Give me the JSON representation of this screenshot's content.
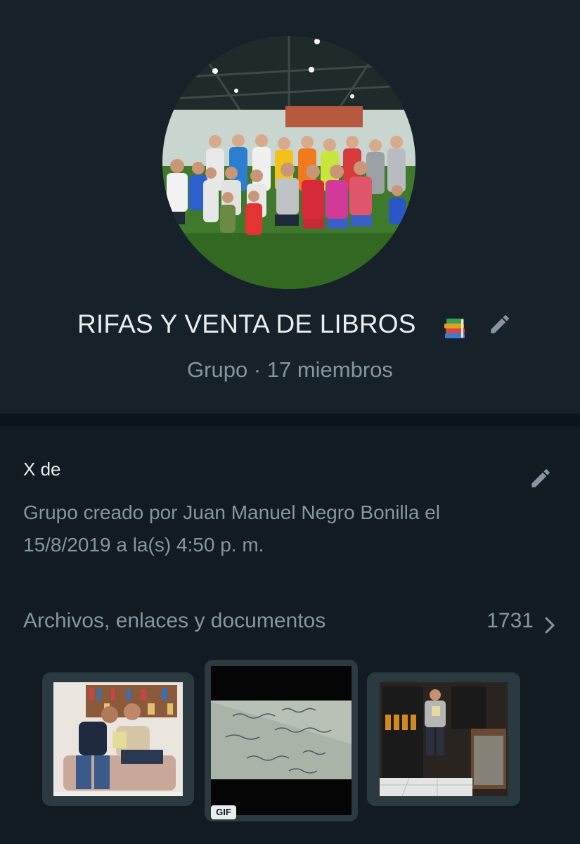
{
  "group": {
    "name": "RIFAS Y VENTA DE LIBROS",
    "name_emoji_icon": "books-icon",
    "subtitle": "Grupo · 17 miembros",
    "avatar": "group-photo-soccer-team"
  },
  "description": {
    "label": "X de",
    "created_text": "Grupo creado por Juan Manuel Negro Bonilla el 15/8/2019 a la(s) 4:50 p. m."
  },
  "media": {
    "label": "Archivos, enlaces y documentos",
    "count": "1731",
    "thumbnails": [
      {
        "kind": "image",
        "description": "two-men-on-sofa-with-book"
      },
      {
        "kind": "gif",
        "badge": "GIF",
        "description": "handwritten-arabic-paper"
      },
      {
        "kind": "image",
        "description": "man-in-shop-with-book"
      }
    ]
  },
  "colors": {
    "background": "#111b21",
    "header_bg": "#17212a",
    "primary_text": "#e9edef",
    "secondary_text": "#8696a0"
  }
}
